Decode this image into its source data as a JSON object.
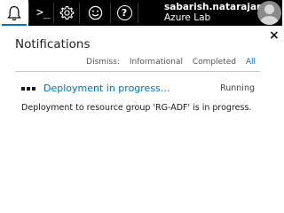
{
  "topbar": {
    "buttons": [
      {
        "icon": "bell-icon",
        "active": true
      },
      {
        "icon": "cloud-shell-icon",
        "label": ">_"
      },
      {
        "icon": "gear-icon"
      },
      {
        "icon": "smiley-feedback-icon"
      },
      {
        "icon": "help-icon",
        "label": "?"
      }
    ],
    "user": {
      "name": "sabarish.natarajan@",
      "directory": "Azure Lab"
    }
  },
  "notifications_panel": {
    "title": "Notifications",
    "close_label": "×",
    "dismiss": {
      "label": "Dismiss:",
      "options": [
        "Informational",
        "Completed",
        "All"
      ]
    },
    "items": [
      {
        "title": "Deployment in progress...",
        "status": "Running",
        "description": "Deployment to resource group 'RG-ADF' is in progress."
      }
    ]
  },
  "colors": {
    "accent": "#0072c6",
    "topbar": "#000000"
  }
}
